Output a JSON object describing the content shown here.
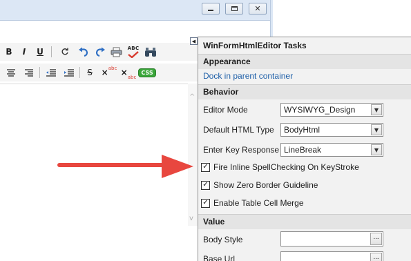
{
  "window": {
    "caption_buttons": [
      {
        "name": "minimize",
        "icon": "minimize-icon"
      },
      {
        "name": "maximize",
        "icon": "maximize-icon"
      },
      {
        "name": "close",
        "icon": "close-icon",
        "glyph": "✕"
      }
    ]
  },
  "toolbar": {
    "row1": {
      "bold": "B",
      "italic": "I",
      "underline": "U",
      "spellcheck_text": "ABC"
    },
    "row2": {
      "strike": "S",
      "superscript": "abc",
      "subscript": "abc",
      "css": "CSS"
    }
  },
  "tasks_panel": {
    "title": "WinFormHtmlEditor Tasks",
    "appearance": {
      "heading": "Appearance",
      "dock_link": "Dock in parent container"
    },
    "behavior": {
      "heading": "Behavior",
      "editor_mode": {
        "label": "Editor Mode",
        "value": "WYSIWYG_Design"
      },
      "default_html_type": {
        "label": "Default HTML Type",
        "value": "BodyHtml"
      },
      "enter_key_response": {
        "label": "Enter Key Response",
        "value": "LineBreak"
      },
      "checkboxes": [
        {
          "label": "Fire Inline SpellChecking On KeyStroke",
          "checked": true
        },
        {
          "label": "Show Zero Border Guideline",
          "checked": true
        },
        {
          "label": "Enable Table Cell Merge",
          "checked": true
        }
      ]
    },
    "value": {
      "heading": "Value",
      "body_style": {
        "label": "Body Style",
        "value": "",
        "button": "..."
      },
      "base_url": {
        "label": "Base Url",
        "value": "",
        "button": "..."
      }
    }
  },
  "colors": {
    "annotation_arrow": "#e8473f",
    "link": "#1e5fa8",
    "undo_redo": "#2f6fc4",
    "css_badge": "#3aa63a"
  }
}
